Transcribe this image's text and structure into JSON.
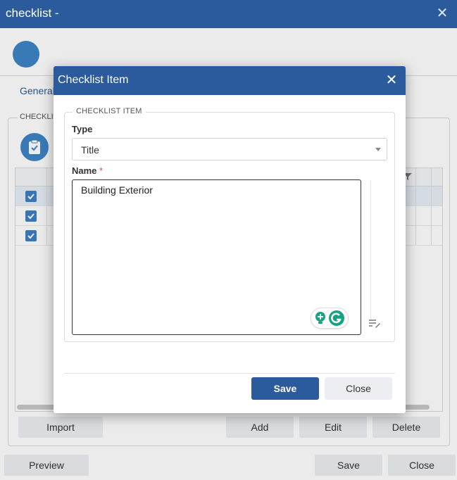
{
  "window": {
    "title": "checklist -",
    "close_glyph": "✕"
  },
  "tabs": {
    "general": "General"
  },
  "section": {
    "legend": "CHECKLI"
  },
  "grid_buttons": {
    "import": "Import",
    "add": "Add",
    "edit": "Edit",
    "delete": "Delete"
  },
  "footer": {
    "preview": "Preview",
    "save": "Save",
    "close": "Close"
  },
  "dialog": {
    "title": "Checklist Item",
    "close_glyph": "✕",
    "legend": "CHECKLIST ITEM",
    "type_label": "Type",
    "type_value": "Title",
    "name_label": "Name",
    "required_mark": "*",
    "name_value": "Building Exterior",
    "save": "Save",
    "close": "Close"
  },
  "colors": {
    "primary": "#2b5b9c",
    "accent": "#3d85c6",
    "button_gray": "#eceef1"
  },
  "icons": {
    "avatar": "avatar-circle",
    "clipboard": "clipboard-check-icon",
    "row_check": "checkbox-checked-icon",
    "filter": "filter-icon",
    "grammarly": "grammarly-icon",
    "suggestion": "lightbulb-plus-icon",
    "edit_lines": "edit-lines-icon"
  }
}
